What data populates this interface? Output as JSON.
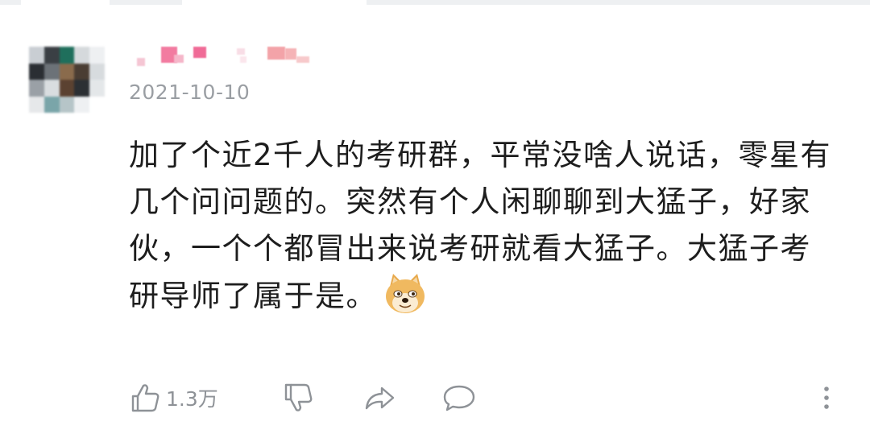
{
  "comment": {
    "date": "2021-10-10",
    "text": "加了个近2千人的考研群，平常没啥人说话，零星有几个问问题的。突然有个人闲聊聊到大猛子，好家伙，一个个都冒出来说考研就看大猛子。大猛子考研导师了属于是。",
    "emoji": "doge-emoji"
  },
  "actions": {
    "like_count": "1.3万",
    "like_icon": "thumbs-up-icon",
    "dislike_icon": "thumbs-down-icon",
    "share_icon": "share-arrow-icon",
    "reply_icon": "comment-bubble-icon",
    "more_icon": "more-vertical-icon"
  },
  "colors": {
    "text": "#1d1d1d",
    "muted": "#9a9ea3",
    "icon": "#8e9297"
  }
}
